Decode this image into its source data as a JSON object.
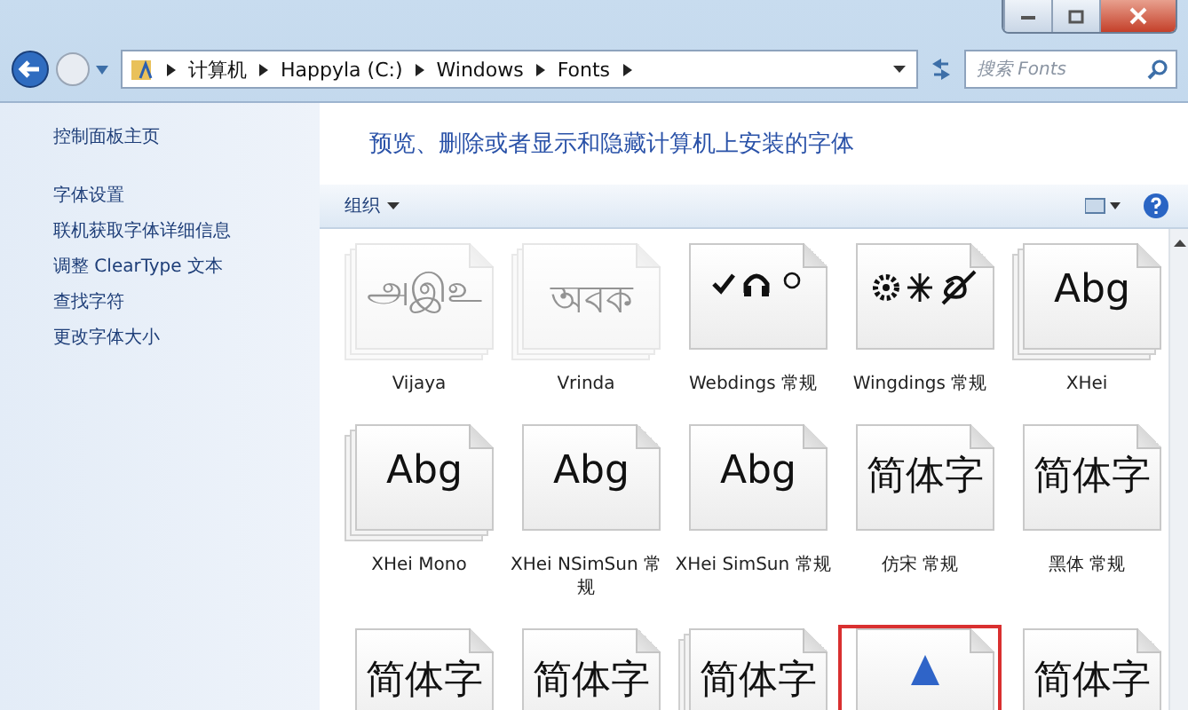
{
  "address_bar": {
    "path": [
      "计算机",
      "Happyla (C:)",
      "Windows",
      "Fonts"
    ]
  },
  "search": {
    "placeholder": "搜索 Fonts"
  },
  "sidebar": {
    "home": "控制面板主页",
    "links": [
      "字体设置",
      "联机获取字体详细信息",
      "调整 ClearType 文本",
      "查找字符",
      "更改字体大小"
    ]
  },
  "heading": "预览、删除或者显示和隐藏计算机上安装的字体",
  "toolbar": {
    "organize": "组织"
  },
  "fonts": [
    {
      "name": "Vijaya",
      "kind": "sample",
      "preview": "அஇஉ",
      "hidden": true,
      "stacked": true,
      "selected": false
    },
    {
      "name": "Vrinda",
      "kind": "sample",
      "preview": "অবক",
      "hidden": true,
      "stacked": true,
      "selected": false
    },
    {
      "name": "Webdings 常规",
      "kind": "webdings",
      "hidden": false,
      "stacked": false,
      "selected": false
    },
    {
      "name": "Wingdings 常规",
      "kind": "wingdings",
      "hidden": false,
      "stacked": false,
      "selected": false
    },
    {
      "name": "XHei",
      "kind": "sample",
      "preview": "Abg",
      "hidden": false,
      "stacked": true,
      "selected": false
    },
    {
      "name": "XHei Mono",
      "kind": "sample",
      "preview": "Abg",
      "hidden": false,
      "stacked": true,
      "selected": false
    },
    {
      "name": "XHei NSimSun 常规",
      "kind": "sample",
      "preview": "Abg",
      "hidden": false,
      "stacked": false,
      "selected": false
    },
    {
      "name": "XHei SimSun 常规",
      "kind": "sample",
      "preview": "Abg",
      "hidden": false,
      "stacked": false,
      "selected": false
    },
    {
      "name": "仿宋 常规",
      "kind": "faint",
      "preview": "简体字",
      "hidden": false,
      "stacked": false,
      "selected": false
    },
    {
      "name": "黑体 常规",
      "kind": "heavy",
      "preview": "简体字",
      "hidden": false,
      "stacked": false,
      "selected": false
    },
    {
      "kind": "faint",
      "preview": "简体字",
      "hidden": false,
      "stacked": false,
      "selected": false
    },
    {
      "kind": "faint",
      "preview": "简体字",
      "hidden": false,
      "stacked": false,
      "selected": false
    },
    {
      "kind": "heavy",
      "preview": "简体字",
      "hidden": false,
      "stacked": true,
      "selected": false
    },
    {
      "kind": "font-file",
      "hidden": false,
      "stacked": false,
      "selected": true
    },
    {
      "kind": "faint",
      "preview": "简体字",
      "hidden": false,
      "stacked": false,
      "selected": false
    }
  ]
}
